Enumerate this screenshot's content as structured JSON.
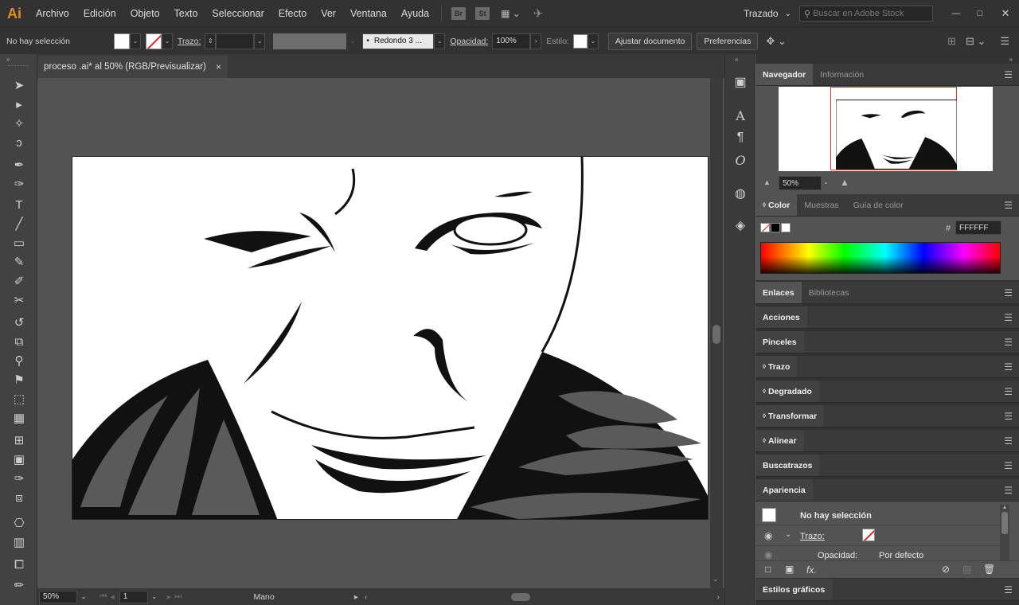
{
  "app": {
    "logo": "Ai"
  },
  "menu": [
    "Archivo",
    "Edición",
    "Objeto",
    "Texto",
    "Seleccionar",
    "Efecto",
    "Ver",
    "Ventana",
    "Ayuda"
  ],
  "menubar_icons": {
    "bridge": "Br",
    "stock": "St"
  },
  "workspace": "Trazado",
  "search_placeholder": "Buscar en Adobe Stock",
  "control": {
    "selection": "No hay selección",
    "stroke_label": "Trazo:",
    "brush": "Redondo 3 ...",
    "opacity_label": "Opacidad:",
    "opacity_value": "100%",
    "style_label": "Estilo:",
    "adjust_doc": "Ajustar documento",
    "preferences": "Preferencias"
  },
  "document": {
    "tab_title": "proceso .ai* al 50% (RGB/Previsualizar)",
    "close": "×"
  },
  "status": {
    "zoom": "50%",
    "page": "1",
    "tool": "Mano"
  },
  "navigator": {
    "tabs": [
      "Navegador",
      "Información"
    ],
    "zoom": "50%"
  },
  "color_panel": {
    "tabs": [
      "Color",
      "Muestras",
      "Guía de color"
    ],
    "hex_label": "#",
    "hex": "FFFFFF"
  },
  "links_panel": {
    "tabs": [
      "Enlaces",
      "Bibliotecas"
    ]
  },
  "collapsed_panels": [
    {
      "label": "Acciones",
      "chevron": ""
    },
    {
      "label": "Pinceles",
      "chevron": ""
    },
    {
      "label": "Trazo",
      "chevron": "◊"
    },
    {
      "label": "Degradado",
      "chevron": "◊"
    },
    {
      "label": "Transformar",
      "chevron": "◊"
    },
    {
      "label": "Alinear",
      "chevron": "◊"
    },
    {
      "label": "Buscatrazos",
      "chevron": ""
    }
  ],
  "appearance": {
    "title": "Apariencia",
    "no_selection": "No hay selección",
    "stroke_label": "Trazo:",
    "opacity_label": "Opacidad:",
    "opacity_value": "Por defecto",
    "fx": "fx."
  },
  "graphic_styles": "Estilos gráficos",
  "colors": {
    "accent": "#e38b2c",
    "panel": "#535353",
    "dark": "#323232"
  }
}
